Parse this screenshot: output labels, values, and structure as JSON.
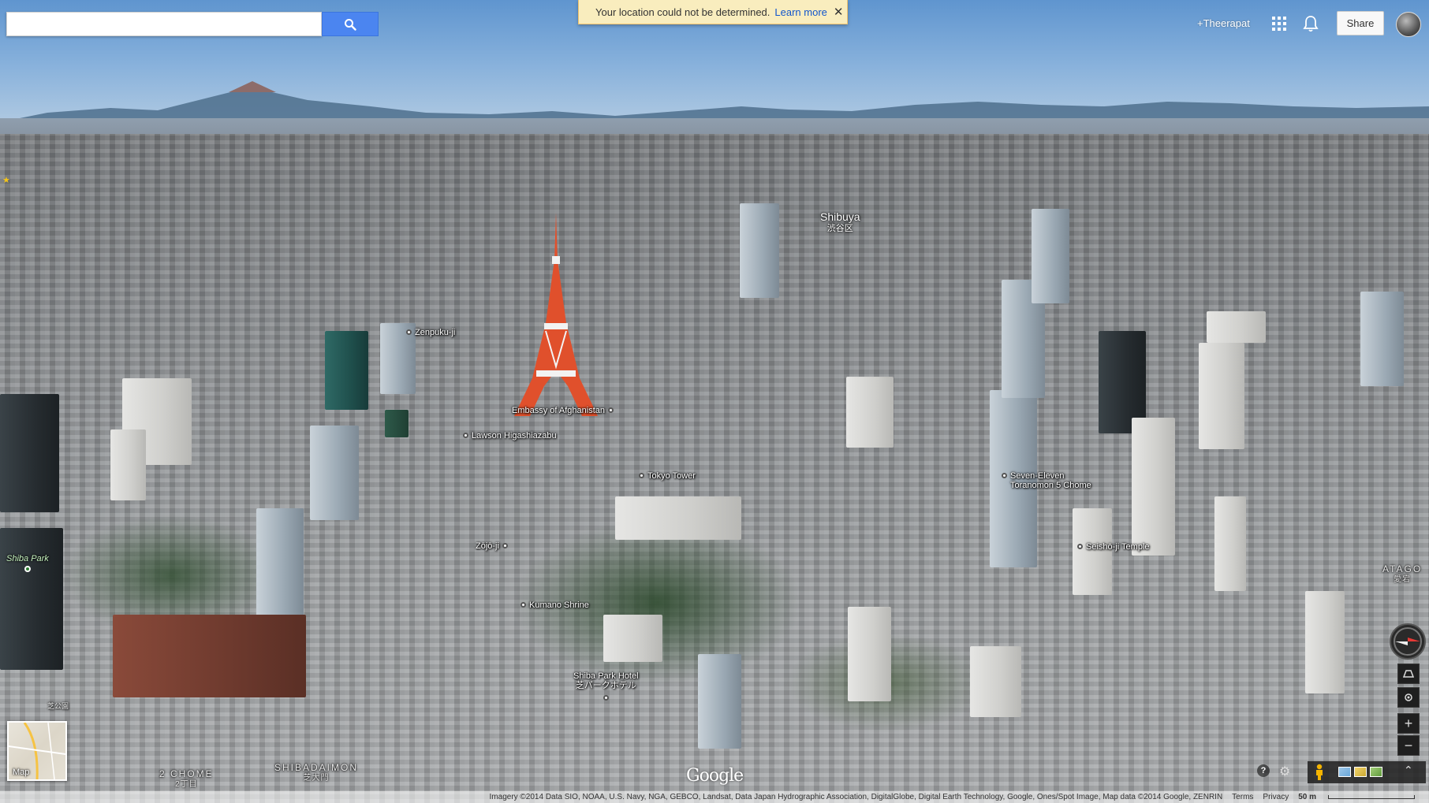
{
  "search": {
    "placeholder": "",
    "value": ""
  },
  "notice": {
    "message": "Your location could not be determined.",
    "link": "Learn more",
    "close": "✕"
  },
  "header": {
    "user": "+Theerapat",
    "share": "Share"
  },
  "map": {
    "areas": [
      {
        "name": "Shibuya",
        "jp": "渋谷区"
      }
    ],
    "parks": [
      {
        "name": "Shiba Park",
        "jp": "芝公園"
      }
    ],
    "districts": [
      {
        "name": "2 CHOME",
        "jp": "2丁目"
      },
      {
        "name": "SHIBADAIMON",
        "jp": "芝大門"
      },
      {
        "name": "ATAGO",
        "jp": "愛宕"
      }
    ],
    "pois": [
      {
        "name": "Zenpuku-ji"
      },
      {
        "name": "Embassy of Afghanistan"
      },
      {
        "name": "Lawson Higashiazabu"
      },
      {
        "name": "Tokyo Tower"
      },
      {
        "name": "Seven-Eleven",
        "name2": "Toranomon 5 Chome"
      },
      {
        "name": "Zōjō-ji"
      },
      {
        "name": "Seishō-ji Temple"
      },
      {
        "name": "Kumano Shrine"
      },
      {
        "name": "Shiba Park Hotel",
        "name2": "芝パークホテル"
      }
    ]
  },
  "minimap": {
    "label": "Map"
  },
  "controls": {
    "zoom_in": "+",
    "zoom_out": "−",
    "help": "?",
    "expand": "⌃"
  },
  "footer": {
    "attribution": "Imagery ©2014 Data SIO, NOAA, U.S. Navy, NGA, GEBCO, Landsat, Data Japan Hydrographic Association, DigitalGlobe, Digital Earth Technology, Google, Ones/Spot Image, Map data ©2014 Google, ZENRIN",
    "terms": "Terms",
    "privacy": "Privacy",
    "scale": "50 m"
  },
  "brand": {
    "logo": "Google"
  },
  "colors": {
    "search_button": "#4b85f0",
    "notice_bg": "#f9edbe",
    "link": "#1155cc"
  }
}
